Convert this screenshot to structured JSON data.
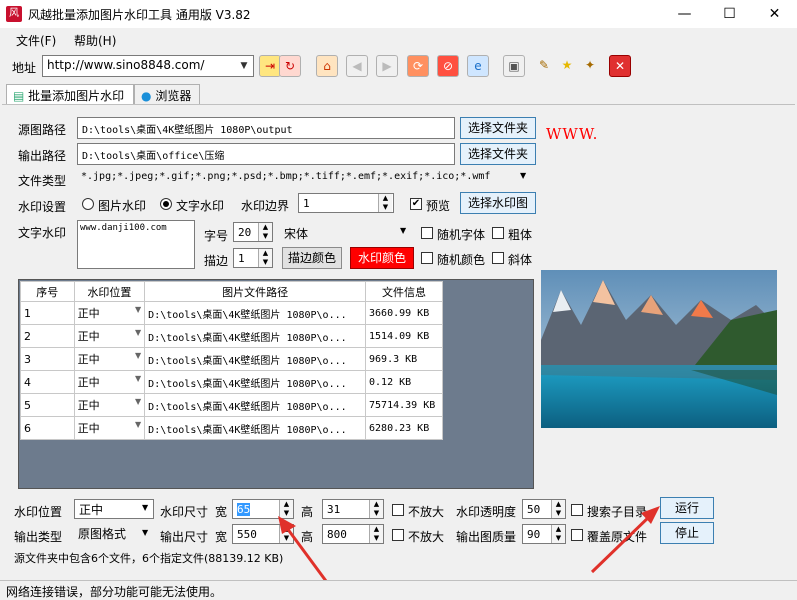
{
  "window": {
    "title": "风越批量添加图片水印工具 通用版 V3.82",
    "minimize": "—",
    "maximize": "☐",
    "close": "✕"
  },
  "menu": [
    {
      "label": "文件(F)"
    },
    {
      "label": "帮助(H)"
    }
  ],
  "toolbar": {
    "address_label": "地址",
    "url": "http://www.sino8848.com/"
  },
  "tabs": [
    {
      "label": "批量添加图片水印"
    },
    {
      "label": "浏览器"
    }
  ],
  "form": {
    "source_label": "源图路径",
    "source_value": "D:\\tools\\桌面\\4K壁纸图片 1080P\\output",
    "source_button": "选择文件夹",
    "output_label": "输出路径",
    "output_value": "D:\\tools\\桌面\\office\\压缩",
    "output_button": "选择文件夹",
    "type_label": "文件类型",
    "type_value": "*.jpg;*.jpeg;*.gif;*.png;*.psd;*.bmp;*.tiff;*.emf;*.exif;*.ico;*.wmf",
    "wm_setting_label": "水印设置",
    "image_wm": "图片水印",
    "text_wm": "文字水印",
    "border_label": "水印边界",
    "border_value": "1",
    "preview": "预览",
    "choose_wm_button": "选择水印图",
    "text_wm_label": "文字水印",
    "text_wm_value": "www.danji100.com",
    "font_size_label": "字号",
    "font_size_value": "20",
    "font_name": "宋体",
    "random_font": "随机字体",
    "bold": "粗体",
    "stroke_label": "描边",
    "stroke_value": "1",
    "stroke_color_button": "描边颜色",
    "wm_color_button": "水印颜色",
    "random_color": "随机颜色",
    "italic": "斜体",
    "preview_text": "WWW."
  },
  "table": {
    "headers": [
      "序号",
      "水印位置",
      "图片文件路径",
      "文件信息"
    ],
    "rows": [
      {
        "no": "1",
        "pos": "正中",
        "path": "D:\\tools\\桌面\\4K壁纸图片 1080P\\o...",
        "info": "3660.99 KB"
      },
      {
        "no": "2",
        "pos": "正中",
        "path": "D:\\tools\\桌面\\4K壁纸图片 1080P\\o...",
        "info": "1514.09 KB"
      },
      {
        "no": "3",
        "pos": "正中",
        "path": "D:\\tools\\桌面\\4K壁纸图片 1080P\\o...",
        "info": "969.3 KB"
      },
      {
        "no": "4",
        "pos": "正中",
        "path": "D:\\tools\\桌面\\4K壁纸图片 1080P\\o...",
        "info": "0.12 KB"
      },
      {
        "no": "5",
        "pos": "正中",
        "path": "D:\\tools\\桌面\\4K壁纸图片 1080P\\o...",
        "info": "75714.39 KB"
      },
      {
        "no": "6",
        "pos": "正中",
        "path": "D:\\tools\\桌面\\4K壁纸图片 1080P\\o...",
        "info": "6280.23 KB"
      }
    ]
  },
  "bottom": {
    "pos_label": "水印位置",
    "pos_value": "正中",
    "wm_size_label": "水印尺寸",
    "width_label": "宽",
    "wm_width": "65",
    "height_label": "高",
    "wm_height": "31",
    "no_enlarge": "不放大",
    "opacity_label": "水印透明度",
    "opacity_value": "50",
    "search_sub": "搜索子目录",
    "run_button": "运行",
    "out_type_label": "输出类型",
    "out_type_value": "原图格式",
    "out_size_label": "输出尺寸",
    "out_width": "550",
    "out_height": "800",
    "quality_label": "输出图质量",
    "quality_value": "90",
    "overwrite": "覆盖原文件",
    "stop_button": "停止",
    "summary": "源文件夹中包含6个文件，6个指定文件(88139.12 KB)"
  },
  "status": "网络连接错误，部分功能可能无法使用。",
  "colors": {
    "accent_blue": "#3c7fb1",
    "wm_color": "#ff0000",
    "arrow_red": "#e0312a",
    "grid_bg": "#6d7b8d"
  }
}
